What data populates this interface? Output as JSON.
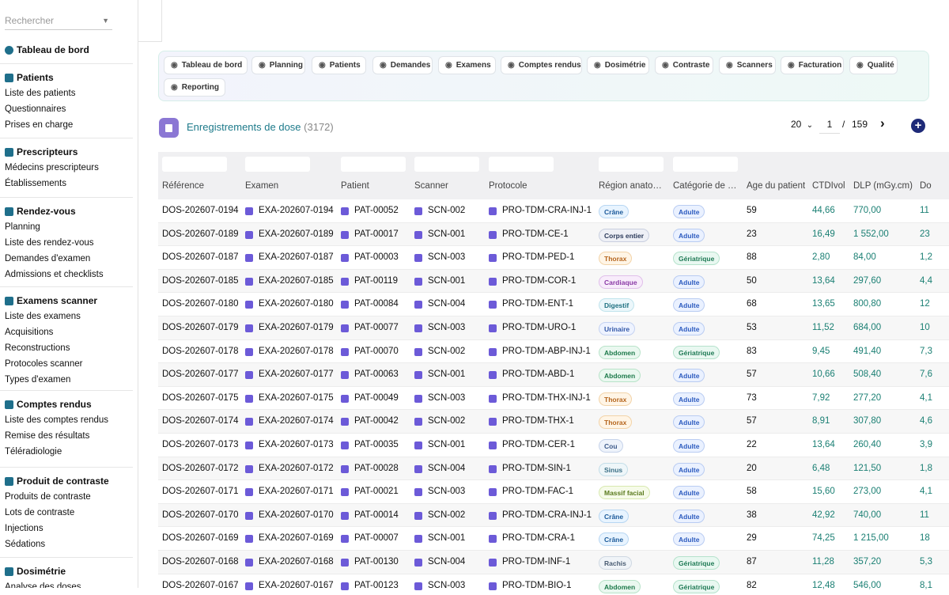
{
  "search": {
    "placeholder": "Rechercher"
  },
  "sidebar": {
    "dashboard": "Tableau de bord",
    "sections": [
      {
        "title": "Patients",
        "icon": "bed-icon",
        "items": [
          "Liste des patients",
          "Questionnaires",
          "Prises en charge"
        ]
      },
      {
        "title": "Prescripteurs",
        "icon": "user-group-icon",
        "items": [
          "Médecins prescripteurs",
          "Établissements"
        ]
      },
      {
        "title": "Rendez-vous",
        "icon": "calendar-check-icon",
        "items": [
          "Planning",
          "Liste des rendez-vous",
          "Demandes d'examen",
          "Admissions et checklists"
        ]
      },
      {
        "title": "Examens scanner",
        "icon": "scanner-icon",
        "items": [
          "Liste des examens",
          "Acquisitions",
          "Reconstructions",
          "Protocoles scanner",
          "Types d'examen"
        ]
      },
      {
        "title": "Comptes rendus",
        "icon": "document-icon",
        "items": [
          "Liste des comptes rendus",
          "Remise des résultats",
          "Téléradiologie"
        ]
      },
      {
        "title": "Produit de contraste",
        "icon": "flask-icon",
        "items": [
          "Produits de contraste",
          "Lots de contraste",
          "Injections",
          "Sédations"
        ]
      },
      {
        "title": "Dosimétrie",
        "icon": "radiation-icon",
        "items": [
          "Analyse des doses"
        ]
      }
    ]
  },
  "nav": [
    {
      "label": "Tableau de bord",
      "icon": "gauge-icon"
    },
    {
      "label": "Planning",
      "icon": "calendar-icon"
    },
    {
      "label": "Patients",
      "icon": "bed-icon"
    },
    {
      "label": "Demandes",
      "icon": "file-icon"
    },
    {
      "label": "Examens",
      "icon": "scanner-icon"
    },
    {
      "label": "Comptes rendus",
      "icon": "document-icon"
    },
    {
      "label": "Dosimétrie",
      "icon": "radiation-icon"
    },
    {
      "label": "Contraste",
      "icon": "flask-icon"
    },
    {
      "label": "Scanners",
      "icon": "circle-icon"
    },
    {
      "label": "Facturation",
      "icon": "invoice-icon"
    },
    {
      "label": "Qualité",
      "icon": "award-icon"
    },
    {
      "label": "Reporting",
      "icon": "chart-icon"
    }
  ],
  "page": {
    "title": "Enregistrements de dose",
    "count": "(3172)"
  },
  "pager": {
    "page_size": "20",
    "current": "1",
    "sep": "/",
    "total": "159"
  },
  "table": {
    "columns": [
      "Référence",
      "Examen",
      "Patient",
      "Scanner",
      "Protocole",
      "Région anato…",
      "Catégorie de …",
      "Âge du patient",
      "CTDIvol",
      "DLP (mGy.cm)",
      "Do"
    ],
    "rows": [
      [
        "DOS-202607-0194",
        "EXA-202607-0194",
        "PAT-00052",
        "SCN-002",
        "PRO-TDM-CRA-INJ-1",
        "Crâne",
        "Adulte",
        "59",
        "44,66",
        "770,00",
        "11"
      ],
      [
        "DOS-202607-0189",
        "EXA-202607-0189",
        "PAT-00017",
        "SCN-001",
        "PRO-TDM-CE-1",
        "Corps entier",
        "Adulte",
        "23",
        "16,49",
        "1 552,00",
        "23"
      ],
      [
        "DOS-202607-0187",
        "EXA-202607-0187",
        "PAT-00003",
        "SCN-003",
        "PRO-TDM-PED-1",
        "Thorax",
        "Gériatrique",
        "88",
        "2,80",
        "84,00",
        "1,2"
      ],
      [
        "DOS-202607-0185",
        "EXA-202607-0185",
        "PAT-00119",
        "SCN-001",
        "PRO-TDM-COR-1",
        "Cardiaque",
        "Adulte",
        "50",
        "13,64",
        "297,60",
        "4,4"
      ],
      [
        "DOS-202607-0180",
        "EXA-202607-0180",
        "PAT-00084",
        "SCN-004",
        "PRO-TDM-ENT-1",
        "Digestif",
        "Adulte",
        "68",
        "13,65",
        "800,80",
        "12"
      ],
      [
        "DOS-202607-0179",
        "EXA-202607-0179",
        "PAT-00077",
        "SCN-003",
        "PRO-TDM-URO-1",
        "Urinaire",
        "Adulte",
        "53",
        "11,52",
        "684,00",
        "10"
      ],
      [
        "DOS-202607-0178",
        "EXA-202607-0178",
        "PAT-00070",
        "SCN-002",
        "PRO-TDM-ABP-INJ-1",
        "Abdomen",
        "Gériatrique",
        "83",
        "9,45",
        "491,40",
        "7,3"
      ],
      [
        "DOS-202607-0177",
        "EXA-202607-0177",
        "PAT-00063",
        "SCN-001",
        "PRO-TDM-ABD-1",
        "Abdomen",
        "Adulte",
        "57",
        "10,66",
        "508,40",
        "7,6"
      ],
      [
        "DOS-202607-0175",
        "EXA-202607-0175",
        "PAT-00049",
        "SCN-003",
        "PRO-TDM-THX-INJ-1",
        "Thorax",
        "Adulte",
        "73",
        "7,92",
        "277,20",
        "4,1"
      ],
      [
        "DOS-202607-0174",
        "EXA-202607-0174",
        "PAT-00042",
        "SCN-002",
        "PRO-TDM-THX-1",
        "Thorax",
        "Adulte",
        "57",
        "8,91",
        "307,80",
        "4,6"
      ],
      [
        "DOS-202607-0173",
        "EXA-202607-0173",
        "PAT-00035",
        "SCN-001",
        "PRO-TDM-CER-1",
        "Cou",
        "Adulte",
        "22",
        "13,64",
        "260,40",
        "3,9"
      ],
      [
        "DOS-202607-0172",
        "EXA-202607-0172",
        "PAT-00028",
        "SCN-004",
        "PRO-TDM-SIN-1",
        "Sinus",
        "Adulte",
        "20",
        "6,48",
        "121,50",
        "1,8"
      ],
      [
        "DOS-202607-0171",
        "EXA-202607-0171",
        "PAT-00021",
        "SCN-003",
        "PRO-TDM-FAC-1",
        "Massif facial",
        "Adulte",
        "58",
        "15,60",
        "273,00",
        "4,1"
      ],
      [
        "DOS-202607-0170",
        "EXA-202607-0170",
        "PAT-00014",
        "SCN-002",
        "PRO-TDM-CRA-INJ-1",
        "Crâne",
        "Adulte",
        "38",
        "42,92",
        "740,00",
        "11"
      ],
      [
        "DOS-202607-0169",
        "EXA-202607-0169",
        "PAT-00007",
        "SCN-001",
        "PRO-TDM-CRA-1",
        "Crâne",
        "Adulte",
        "29",
        "74,25",
        "1 215,00",
        "18"
      ],
      [
        "DOS-202607-0168",
        "EXA-202607-0168",
        "PAT-00130",
        "SCN-004",
        "PRO-TDM-INF-1",
        "Rachis",
        "Gériatrique",
        "87",
        "11,28",
        "357,20",
        "5,3"
      ],
      [
        "DOS-202607-0167",
        "EXA-202607-0167",
        "PAT-00123",
        "SCN-003",
        "PRO-TDM-BIO-1",
        "Abdomen",
        "Gériatrique",
        "82",
        "12,48",
        "546,00",
        "8,1"
      ]
    ]
  },
  "region_colors": {
    "Crâne": [
      "#e8f4ff",
      "#1c5a9a",
      "#b7d6f2"
    ],
    "Corps entier": [
      "#eef0f6",
      "#2b3a5a",
      "#c9cfdf"
    ],
    "Thorax": [
      "#fff5e6",
      "#b5651d",
      "#f2d3a8"
    ],
    "Cardiaque": [
      "#f8ecfb",
      "#8b3aa6",
      "#e0bfea"
    ],
    "Digestif": [
      "#ecf7fb",
      "#1e7080",
      "#bfe3ec"
    ],
    "Urinaire": [
      "#eef3ff",
      "#3257a8",
      "#c4d2f2"
    ],
    "Abdomen": [
      "#eaf8f0",
      "#1d7a4b",
      "#b8e3c9"
    ],
    "Cou": [
      "#eef3fb",
      "#3d5a8a",
      "#c6d3ea"
    ],
    "Sinus": [
      "#eef6f9",
      "#3a6f86",
      "#c3dde8"
    ],
    "Massif facial": [
      "#f6fbe9",
      "#5a7a1d",
      "#d8e9b0"
    ],
    "Rachis": [
      "#f0f4f8",
      "#4a5d73",
      "#cfd8e2"
    ]
  },
  "category_colors": {
    "Adulte": [
      "#eaf1ff",
      "#2c5bbf",
      "#b9ccf2"
    ],
    "Gériatrique": [
      "#e9f8f1",
      "#1f7a55",
      "#b5e2cc"
    ]
  }
}
